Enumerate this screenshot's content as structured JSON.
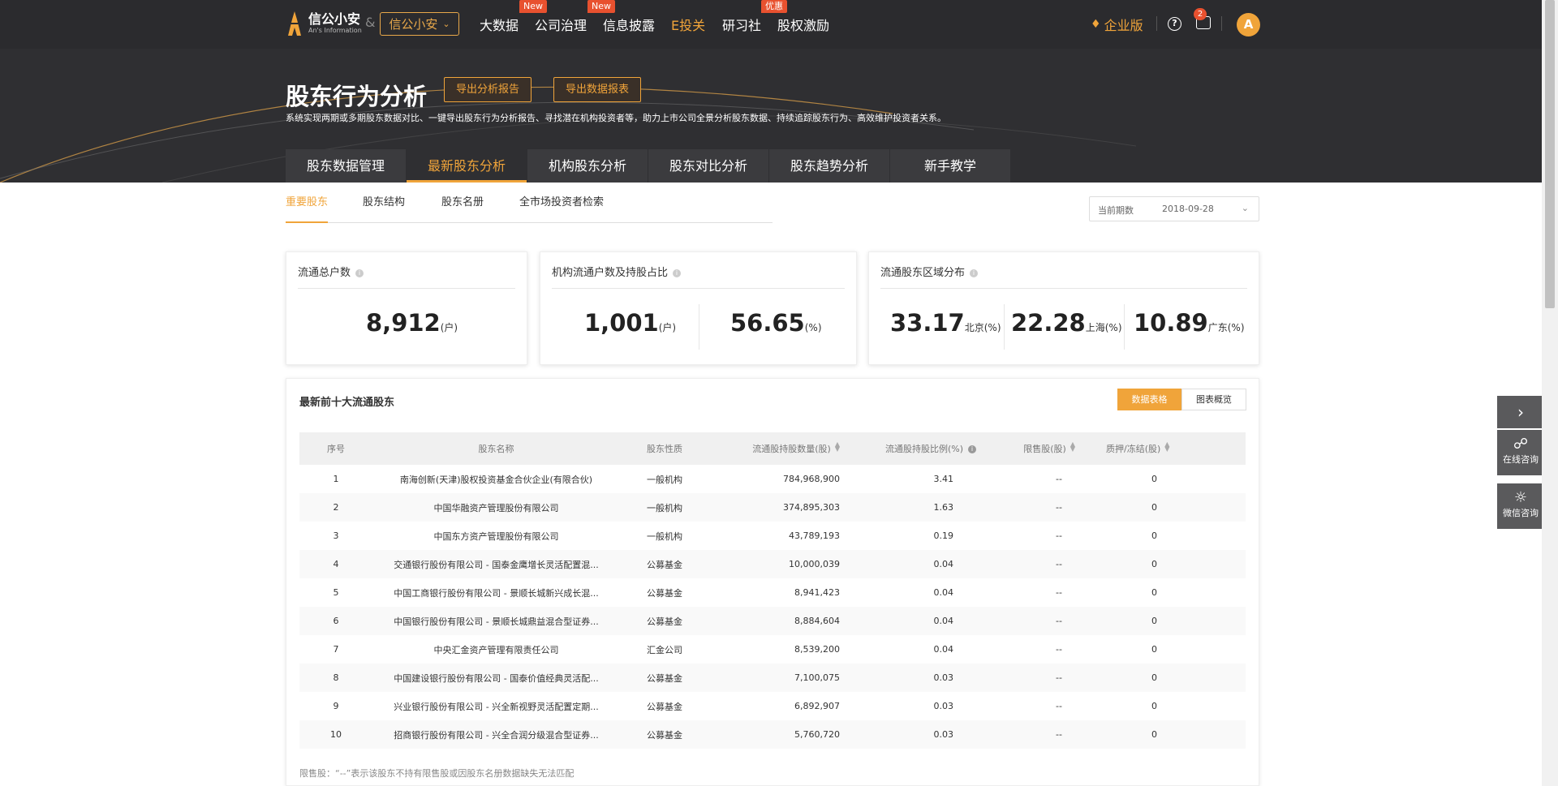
{
  "header": {
    "brand_name": "信公小安",
    "brand_sub": "An's Information",
    "amp": "&",
    "product_select": "信公小安",
    "nav": [
      {
        "label": "大数据",
        "badge": ""
      },
      {
        "label": "公司治理",
        "badge": "New"
      },
      {
        "label": "信息披露",
        "badge": "New"
      },
      {
        "label": "E投关",
        "badge": ""
      },
      {
        "label": "研习社",
        "badge": "优惠"
      },
      {
        "label": "股权激励",
        "badge": ""
      }
    ],
    "enterprise": "企业版",
    "message_count": "2",
    "help": "?"
  },
  "hero": {
    "title": "股东行为分析",
    "btn_report": "导出分析报告",
    "btn_data": "导出数据报表",
    "desc": "系统实现两期或多期股东数据对比、一键导出股东行为分析报告、寻找潜在机构投资者等，助力上市公司全景分析股东数据、持续追踪股东行为、高效维护投资者关系。",
    "tabs": [
      "股东数据管理",
      "最新股东分析",
      "机构股东分析",
      "股东对比分析",
      "股东趋势分析",
      "新手教学"
    ]
  },
  "subtabs": [
    "重要股东",
    "股东结构",
    "股东名册",
    "全市场投资者检索"
  ],
  "period": {
    "label": "当前期数",
    "value": "2018-09-28"
  },
  "cards": {
    "total": {
      "title": "流通总户数",
      "value": "8,912",
      "unit": "(户)"
    },
    "institution": {
      "title": "机构流通户数及持股占比",
      "count": "1,001",
      "count_unit": "(户)",
      "ratio": "56.65",
      "ratio_unit": "(%)"
    },
    "region": {
      "title": "流通股东区域分布",
      "items": [
        {
          "value": "33.17",
          "unit": "北京(%)"
        },
        {
          "value": "22.28",
          "unit": "上海(%)"
        },
        {
          "value": "10.89",
          "unit": "广东(%)"
        }
      ]
    }
  },
  "table": {
    "title": "最新前十大流通股东",
    "toggle_table": "数据表格",
    "toggle_chart": "图表概览",
    "columns": [
      "序号",
      "股东名称",
      "股东性质",
      "流通股持股数量(股)",
      "流通股持股比例(%)",
      "限售股(股)",
      "质押/冻结(股)"
    ],
    "rows": [
      [
        "1",
        "南海创新(天津)股权投资基金合伙企业(有限合伙)",
        "一般机构",
        "784,968,900",
        "3.41",
        "--",
        "0"
      ],
      [
        "2",
        "中国华融资产管理股份有限公司",
        "一般机构",
        "374,895,303",
        "1.63",
        "--",
        "0"
      ],
      [
        "3",
        "中国东方资产管理股份有限公司",
        "一般机构",
        "43,789,193",
        "0.19",
        "--",
        "0"
      ],
      [
        "4",
        "交通银行股份有限公司 - 国泰金鹰增长灵活配置混...",
        "公募基金",
        "10,000,039",
        "0.04",
        "--",
        "0"
      ],
      [
        "5",
        "中国工商银行股份有限公司 - 景顺长城新兴成长混...",
        "公募基金",
        "8,941,423",
        "0.04",
        "--",
        "0"
      ],
      [
        "6",
        "中国银行股份有限公司 - 景顺长城鼎益混合型证券...",
        "公募基金",
        "8,884,604",
        "0.04",
        "--",
        "0"
      ],
      [
        "7",
        "中央汇金资产管理有限责任公司",
        "汇金公司",
        "8,539,200",
        "0.04",
        "--",
        "0"
      ],
      [
        "8",
        "中国建设银行股份有限公司 - 国泰价值经典灵活配...",
        "公募基金",
        "7,100,075",
        "0.03",
        "--",
        "0"
      ],
      [
        "9",
        "兴业银行股份有限公司 - 兴全新视野灵活配置定期...",
        "公募基金",
        "6,892,907",
        "0.03",
        "--",
        "0"
      ],
      [
        "10",
        "招商银行股份有限公司 - 兴全合润分级混合型证券...",
        "公募基金",
        "5,760,720",
        "0.03",
        "--",
        "0"
      ]
    ],
    "note": "限售股：“--”表示该股东不持有限售股或因股东名册数据缺失无法匹配"
  },
  "float": {
    "online": "在线咨询",
    "wechat": "微信咨询"
  }
}
